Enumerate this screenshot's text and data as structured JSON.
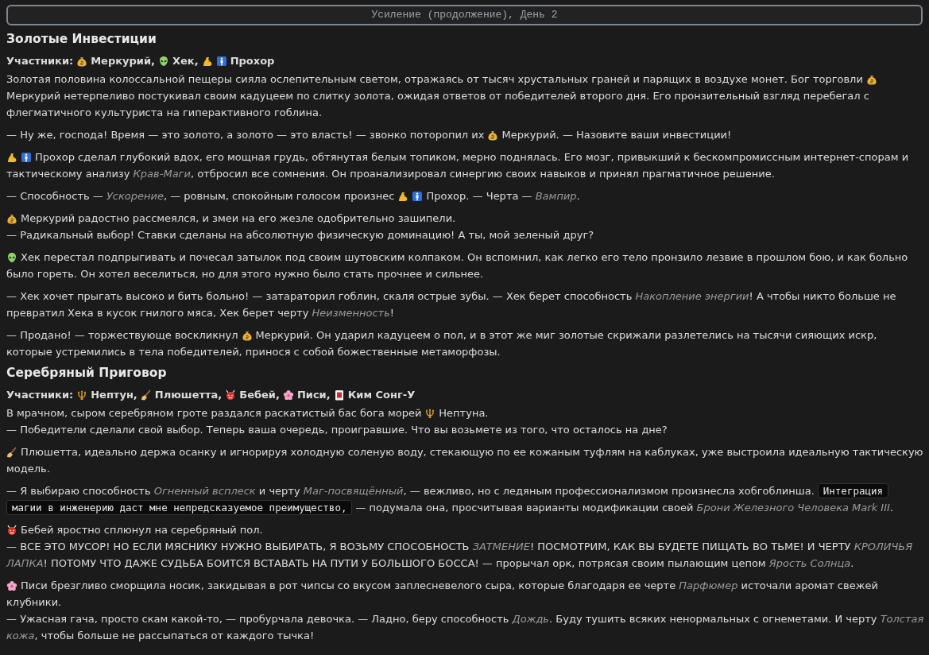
{
  "header": {
    "title": "Усиление (продолжение), День 2"
  },
  "sections": [
    {
      "title": "Золотые Инвестиции",
      "participants_label": "Участники:",
      "participants": [
        {
          "kind": "moneybag"
        },
        {
          "kind": "name",
          "text": "Меркурий,"
        },
        {
          "kind": "alien"
        },
        {
          "kind": "name",
          "text": "Хек,"
        },
        {
          "kind": "muscle"
        },
        {
          "kind": "mansign"
        },
        {
          "kind": "name",
          "text": "Прохор"
        }
      ],
      "paragraphs": [
        [
          [
            {
              "kind": "text",
              "text": "Золотая половина колоссальной пещеры сияла ослепительным светом, отражаясь от тысяч хрустальных граней и парящих в воздухе монет. Бог торговли"
            },
            {
              "kind": "moneybag"
            }
          ],
          [
            {
              "kind": "text",
              "text": "Меркурий нетерпеливо постукивал своим кадуцеем по слитку золота, ожидая ответов от победителей второго дня. Его пронзительный взгляд перебегал с"
            }
          ],
          [
            {
              "kind": "text",
              "text": "флегматичного культуриста на гиперактивного гоблина."
            }
          ]
        ],
        [
          [
            {
              "kind": "text",
              "text": "— Ну же, господа! Время — это золото, а золото — это власть! — звонко поторопил их"
            },
            {
              "kind": "moneybag"
            },
            {
              "kind": "text",
              "text": "Меркурий. — Назовите ваши инвестиции!"
            }
          ]
        ],
        [
          [
            {
              "kind": "muscle"
            },
            {
              "kind": "mansign"
            },
            {
              "kind": "text",
              "text": "Прохор сделал глубокий вдох, его мощная грудь, обтянутая белым топиком, мерно поднялась. Его мозг, привыкший к бескомпромиссным интернет-спорам и"
            }
          ],
          [
            {
              "kind": "text",
              "text": "тактическому анализу *Крав-Маги*, отбросил все сомнения. Он проанализировал синергию своих навыков и принял прагматичное решение."
            }
          ]
        ],
        [
          [
            {
              "kind": "text",
              "text": "— Способность — *Ускорение*, — ровным, спокойным голосом произнес"
            },
            {
              "kind": "muscle"
            },
            {
              "kind": "mansign"
            },
            {
              "kind": "text",
              "text": "Прохор. — Черта — *Вампир*."
            }
          ]
        ],
        [
          [
            {
              "kind": "moneybag"
            },
            {
              "kind": "text",
              "text": "Меркурий радостно рассмеялся, и змеи на его жезле одобрительно зашипели."
            }
          ],
          [
            {
              "kind": "text",
              "text": "— Радикальный выбор! Ставки сделаны на абсолютную физическую доминацию! А ты, мой зеленый друг?"
            }
          ]
        ],
        [
          [
            {
              "kind": "alien"
            },
            {
              "kind": "text",
              "text": "Хек перестал подпрыгивать и почесал затылок под своим шутовским колпаком. Он вспомнил, как легко его тело пронзило лезвие в прошлом бою, и как больно"
            }
          ],
          [
            {
              "kind": "text",
              "text": "было гореть. Он хотел веселиться, но для этого нужно было стать прочнее и сильнее."
            }
          ]
        ],
        [
          [
            {
              "kind": "text",
              "text": "— Хек хочет прыгать высоко и бить больно! — затараторил гоблин, скаля острые зубы. — Хек берет способность *Накопление энергии*! А чтобы никто больше не"
            }
          ],
          [
            {
              "kind": "text",
              "text": "превратил Хека в кусок гнилого мяса, Хек берет черту *Неизменность*!"
            }
          ]
        ],
        [
          [
            {
              "kind": "text",
              "text": "— Продано! — торжествующе воскликнул"
            },
            {
              "kind": "moneybag"
            },
            {
              "kind": "text",
              "text": "Меркурий. Он ударил кадуцеем о пол, и в этот же миг золотые скрижали разлетелись на тысячи сияющих искр,"
            }
          ],
          [
            {
              "kind": "text",
              "text": "которые устремились в тела победителей, принося с собой божественные метаморфозы."
            }
          ]
        ]
      ]
    },
    {
      "title": "Серебряный Приговор",
      "participants_label": "Участники:",
      "participants": [
        {
          "kind": "trident"
        },
        {
          "kind": "name",
          "text": "Нептун,"
        },
        {
          "kind": "broom"
        },
        {
          "kind": "name",
          "text": "Плюшетта,"
        },
        {
          "kind": "devil"
        },
        {
          "kind": "name",
          "text": "Бебей,"
        },
        {
          "kind": "flower"
        },
        {
          "kind": "name",
          "text": "Писи,"
        },
        {
          "kind": "tile"
        },
        {
          "kind": "name",
          "text": "Ким Сонг-У"
        }
      ],
      "paragraphs": [
        [
          [
            {
              "kind": "text",
              "text": "В мрачном, сыром серебряном гроте раздался раскатистый бас бога морей"
            },
            {
              "kind": "trident"
            },
            {
              "kind": "text",
              "text": "Нептуна."
            }
          ],
          [
            {
              "kind": "text",
              "text": "— Победители сделали свой выбор. Теперь ваша очередь, проигравшие. Что вы возьмете из того, что осталось на дне?"
            }
          ]
        ],
        [
          [
            {
              "kind": "broom"
            },
            {
              "kind": "text",
              "text": "Плюшетта, идеально держа осанку и игнорируя холодную соленую воду, стекающую по ее кожаным туфлям на каблуках, уже выстроила идеальную тактическую"
            }
          ],
          [
            {
              "kind": "text",
              "text": "модель."
            }
          ]
        ],
        [
          [
            {
              "kind": "text",
              "text": "— Я выбираю способность *Огненный всплеск* и черту *Маг-посвящённый*, — вежливо, но с ледяным профессионализмом произнесла хобгоблинша."
            },
            {
              "kind": "code",
              "text": "Интеграция"
            }
          ],
          [
            {
              "kind": "code",
              "text": "магии в инженерию даст мне непредсказуемое преимущество,"
            },
            {
              "kind": "text",
              "text": "— подумала она, просчитывая варианты модификации своей *Брони Железного Человека Mark III*."
            }
          ]
        ],
        [
          [
            {
              "kind": "devil"
            },
            {
              "kind": "text",
              "text": "Бебей яростно сплюнул на серебряный пол."
            }
          ],
          [
            {
              "kind": "text",
              "text": "— ВСЕ ЭТО МУСОР! НО ЕСЛИ МЯСНИКУ НУЖНО ВЫБИРАТЬ, Я ВОЗЬМУ СПОСОБНОСТЬ *ЗАТМЕНИЕ*! ПОСМОТРИМ, КАК ВЫ БУДЕТЕ ПИЩАТЬ ВО ТЬМЕ! И ЧЕРТУ *КРОЛИЧЬЯ*"
            }
          ],
          [
            {
              "kind": "text",
              "text": "*ЛАПКА*! ПОТОМУ ЧТО ДАЖЕ СУДЬБА БОИТСЯ ВСТАВАТЬ НА ПУТИ У БОЛЬШОГО БОССА! — прорычал орк, потрясая своим пылающим цепом *Ярость Солнца*."
            }
          ]
        ],
        [
          [
            {
              "kind": "flower"
            },
            {
              "kind": "text",
              "text": "Писи брезгливо сморщила носик, закидывая в рот чипсы со вкусом заплесневелого сыра, которые благодаря ее черте *Парфюмер* источали аромат свежей"
            }
          ],
          [
            {
              "kind": "text",
              "text": "клубники."
            }
          ],
          [
            {
              "kind": "text",
              "text": "— Ужасная гача, просто скам какой-то, — пробурчала девочка. — Ладно, беру способность *Дождь*. Буду тушить всяких ненормальных с огнеметами. И черту *Толстая*"
            }
          ],
          [
            {
              "kind": "text",
              "text": "*кожа*, чтобы больше не рассыпаться от каждого тычка!"
            }
          ]
        ]
      ]
    }
  ]
}
